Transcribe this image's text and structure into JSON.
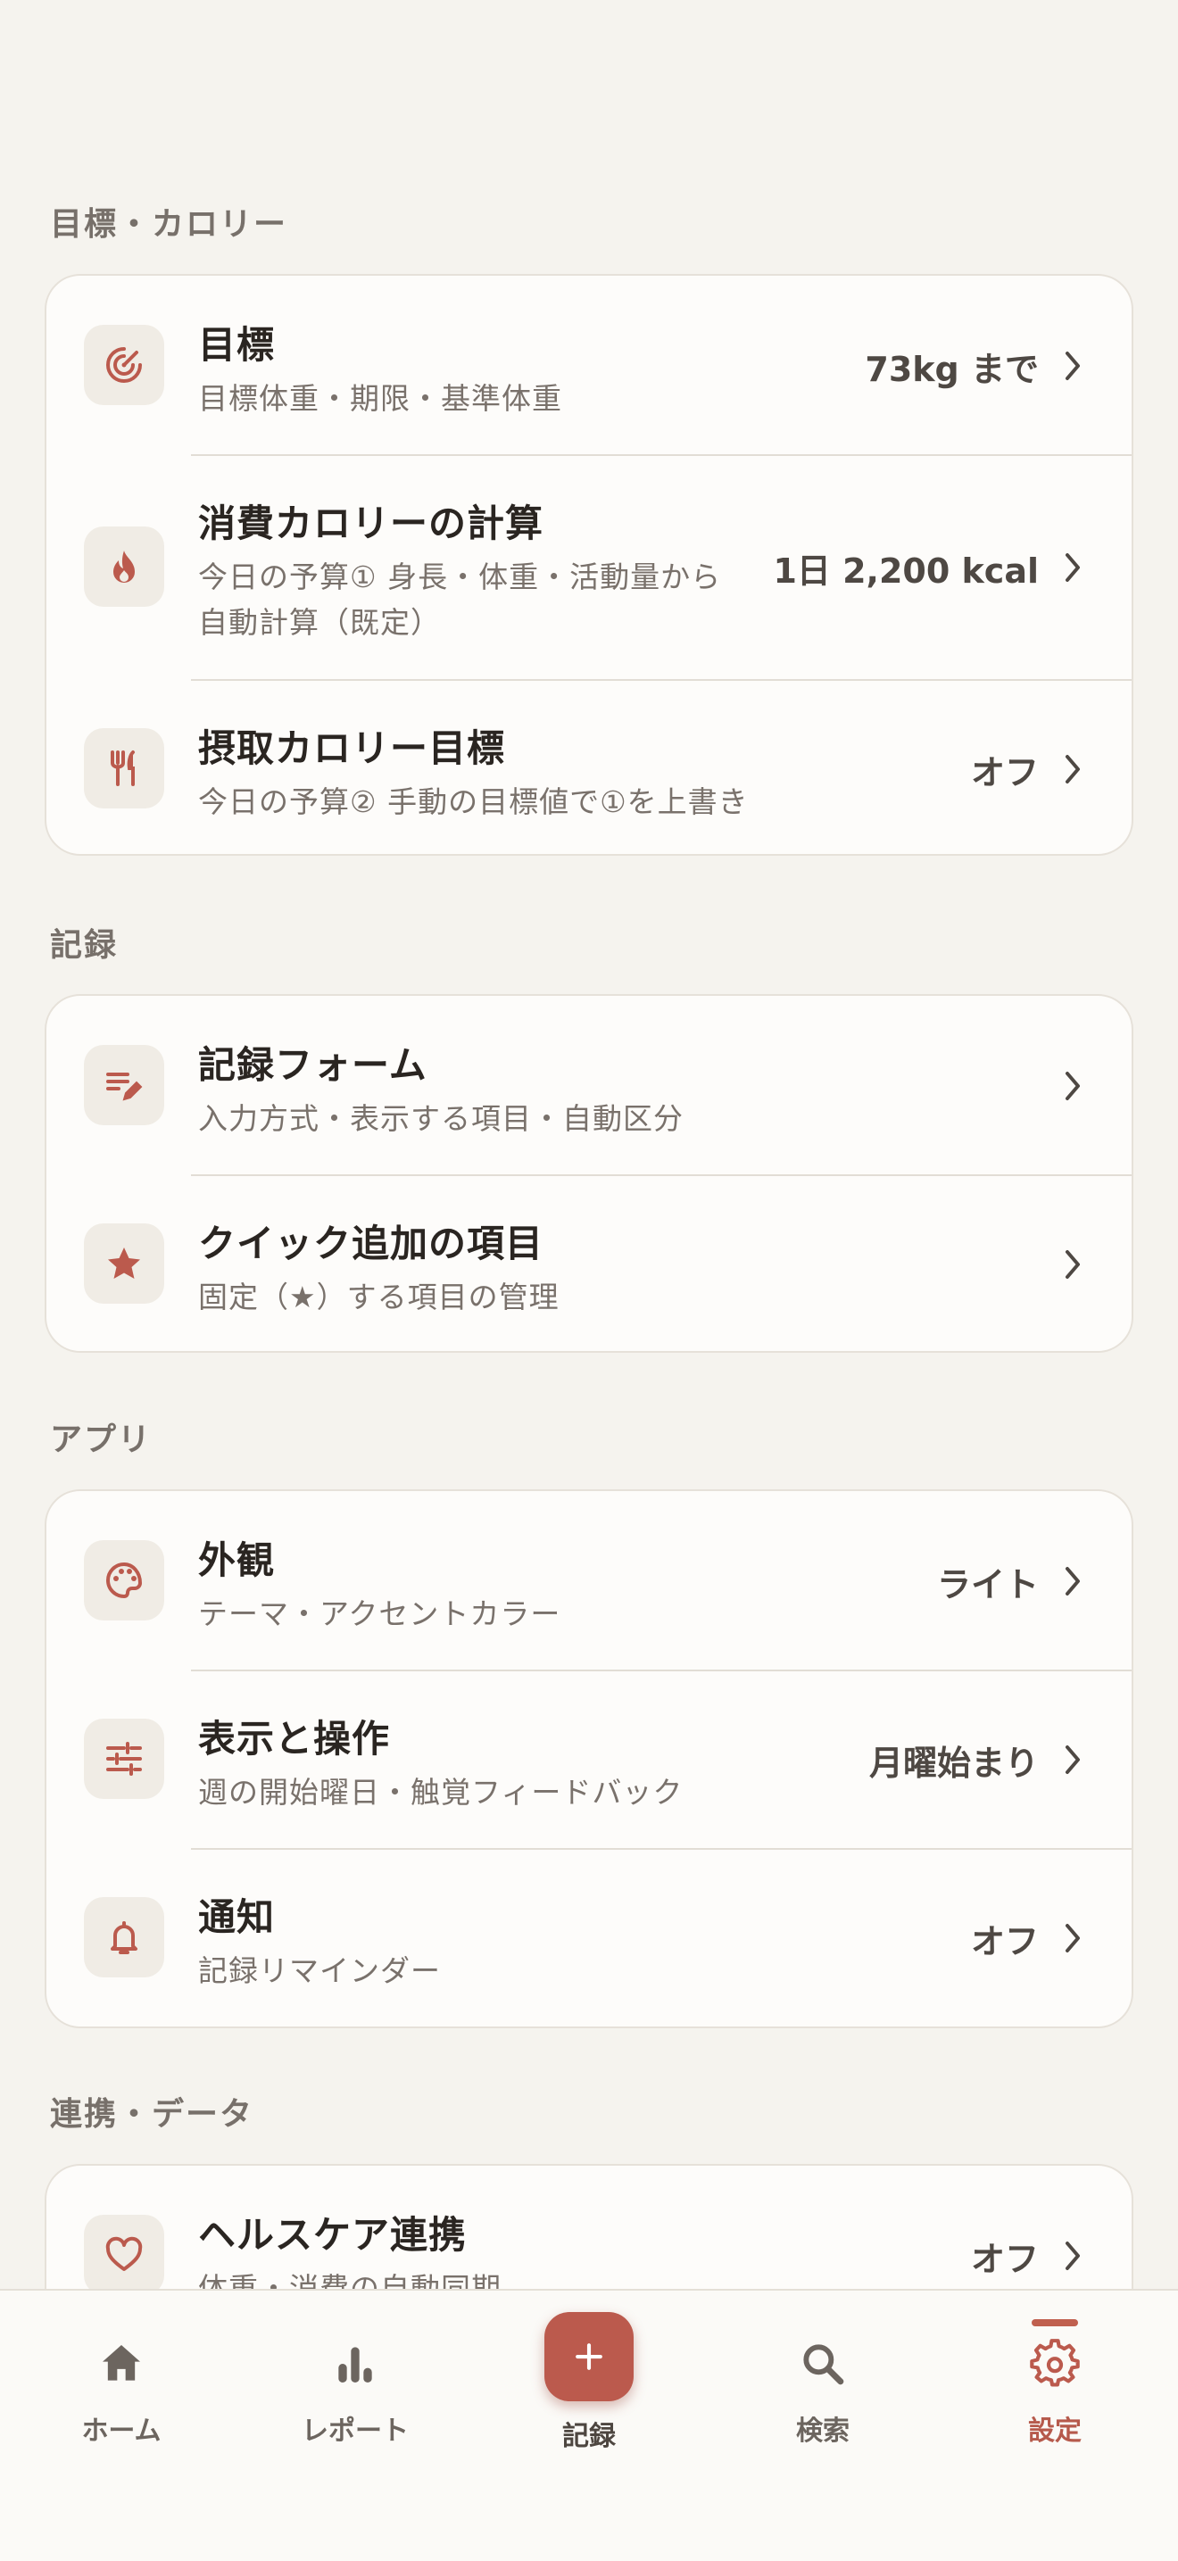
{
  "colors": {
    "accent": "#bb5a4d",
    "background": "#f5f3ee",
    "card": "#fdfcfa"
  },
  "sections": {
    "goals": {
      "title": "目標・カロリー",
      "items": [
        {
          "title": "目標",
          "subtitle": "目標体重・期限・基準体重",
          "value": "73kg まで",
          "icon": "target-icon"
        },
        {
          "title": "消費カロリーの計算",
          "subtitle_line1": "今日の予算① 身長・体重・活動量から",
          "subtitle_line2": "自動計算（既定）",
          "value": "1日 2,200 kcal",
          "icon": "flame-icon"
        },
        {
          "title": "摂取カロリー目標",
          "subtitle": "今日の予算② 手動の目標値で①を上書き",
          "value": "オフ",
          "icon": "fork-knife-icon"
        }
      ]
    },
    "records": {
      "title": "記録",
      "items": [
        {
          "title": "記録フォーム",
          "subtitle": "入力方式・表示する項目・自動区分",
          "icon": "edit-list-icon"
        },
        {
          "title": "クイック追加の項目",
          "subtitle": "固定（★）する項目の管理",
          "icon": "star-icon"
        }
      ]
    },
    "app": {
      "title": "アプリ",
      "items": [
        {
          "title": "外観",
          "subtitle": "テーマ・アクセントカラー",
          "value": "ライト",
          "icon": "palette-icon"
        },
        {
          "title": "表示と操作",
          "subtitle": "週の開始曜日・触覚フィードバック",
          "value": "月曜始まり",
          "icon": "sliders-icon"
        },
        {
          "title": "通知",
          "subtitle": "記録リマインダー",
          "value": "オフ",
          "icon": "bell-icon"
        }
      ]
    },
    "integration": {
      "title": "連携・データ",
      "items": [
        {
          "title": "ヘルスケア連携",
          "subtitle": "体重・消費の自動同期",
          "value": "オフ",
          "icon": "heart-icon"
        }
      ]
    }
  },
  "tabbar": {
    "home": "ホーム",
    "reports": "レポート",
    "record": "記録",
    "search": "検索",
    "settings": "設定",
    "active": "settings"
  }
}
